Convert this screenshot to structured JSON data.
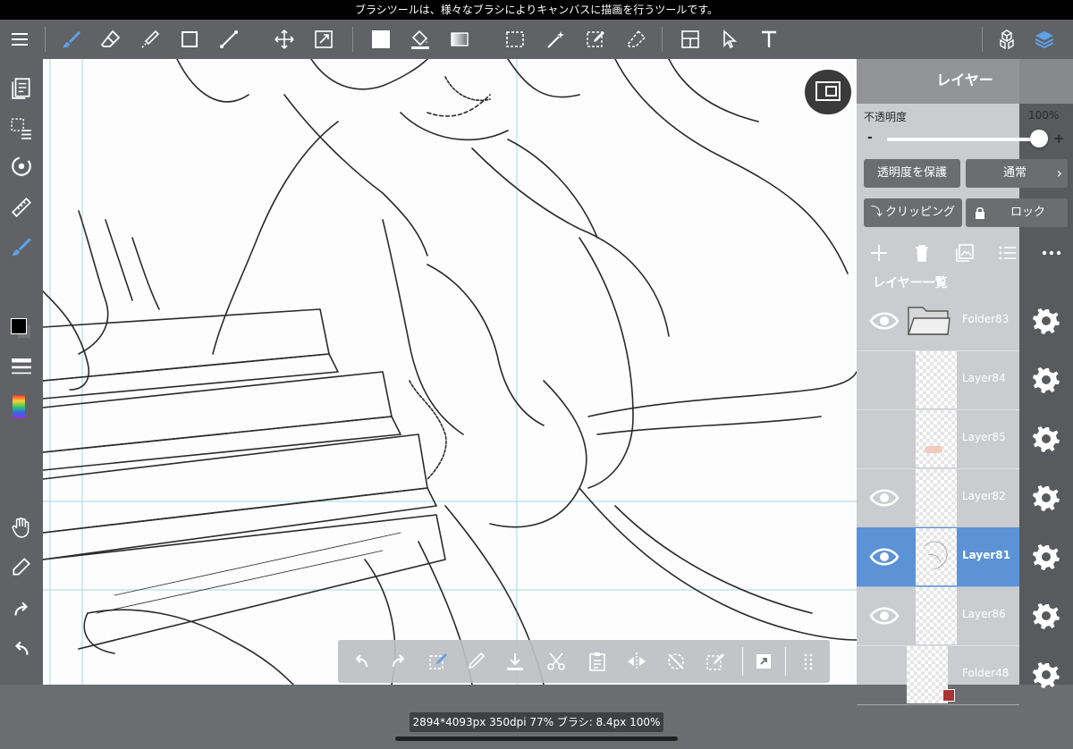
{
  "tip": "ブラシツールは、様々なブラシによりキャンバスに描画を行うツールです。",
  "toolbar": {
    "tools": [
      "menu-icon",
      "brush-icon",
      "eraser-icon",
      "smudge-icon",
      "shape-icon",
      "line-icon",
      "move-icon",
      "transform-icon",
      "fill-rect-icon",
      "bucket-icon",
      "gradation-icon",
      "select-rect-icon",
      "magic-wand-icon",
      "select-pen-icon",
      "select-eraser-icon",
      "frame-icon",
      "select-arrow-icon",
      "text-icon",
      "material-icon",
      "layers-icon"
    ]
  },
  "layers_panel": {
    "title": "レイヤー",
    "opacity_label": "不透明度",
    "opacity_value": "100%",
    "opacity_fraction": 1.0,
    "minus": "-",
    "plus": "+",
    "protect_alpha": "透明度を保護",
    "blend_mode": "通常",
    "clipping": "クリッピング",
    "lock": "ロック",
    "list_label": "レイヤー一覧",
    "layers": [
      {
        "name": "Folder83",
        "visible": true,
        "type": "folder",
        "selected": false
      },
      {
        "name": "Layer84",
        "visible": false,
        "type": "layer",
        "selected": false
      },
      {
        "name": "Layer85",
        "visible": false,
        "type": "layer",
        "selected": false
      },
      {
        "name": "Layer82",
        "visible": true,
        "type": "layer",
        "selected": false
      },
      {
        "name": "Layer81",
        "visible": true,
        "type": "layer",
        "selected": true
      },
      {
        "name": "Layer86",
        "visible": true,
        "type": "layer",
        "selected": false
      },
      {
        "name": "Folder48",
        "visible": false,
        "type": "folder",
        "selected": false
      }
    ]
  },
  "status": "2894*4093px 350dpi 77% ブラシ: 8.4px 100%",
  "colors": {
    "selected_row": "#5b93d6",
    "primary_color": "#000000",
    "secondary_color": "#ffffff"
  }
}
